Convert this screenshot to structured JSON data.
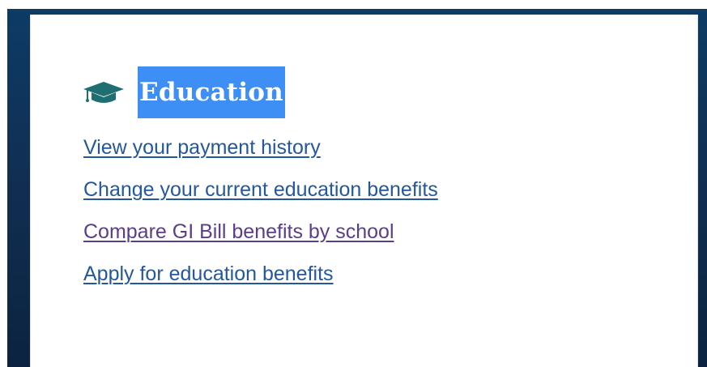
{
  "section": {
    "icon": "graduation-cap-icon",
    "title": "Education"
  },
  "links": [
    {
      "label": "View your payment history",
      "visited": false
    },
    {
      "label": "Change your current education benefits",
      "visited": false
    },
    {
      "label": "Compare GI Bill benefits by school",
      "visited": true
    },
    {
      "label": "Apply for education benefits",
      "visited": false
    }
  ],
  "colors": {
    "frame": "#112e51",
    "title_highlight": "#3d8ff5",
    "icon": "#1f6f72",
    "link": "#23589e",
    "link_visited": "#5b3c8f"
  }
}
